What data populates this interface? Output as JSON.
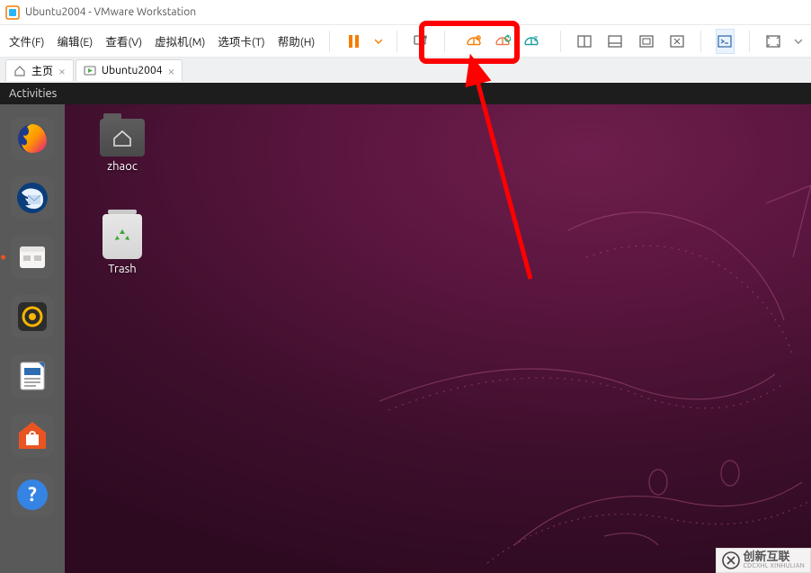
{
  "window": {
    "title": "Ubuntu2004 - VMware Workstation"
  },
  "menu": {
    "file": "文件(F)",
    "edit": "编辑(E)",
    "view": "查看(V)",
    "vm": "虚拟机(M)",
    "tabs": "选项卡(T)",
    "help": "帮助(H)"
  },
  "tabs": {
    "home": "主页",
    "vm": "Ubuntu2004"
  },
  "ubuntu": {
    "activities": "Activities",
    "icons": {
      "home_folder": "zhaoc",
      "trash": "Trash"
    }
  },
  "watermark": {
    "brand": "创新互联",
    "sub": "CDCXHL XINHULIAN"
  },
  "colors": {
    "annotation_red": "#ff0000",
    "vmware_orange": "#f57c00",
    "ubuntu_accent": "#E95420"
  }
}
